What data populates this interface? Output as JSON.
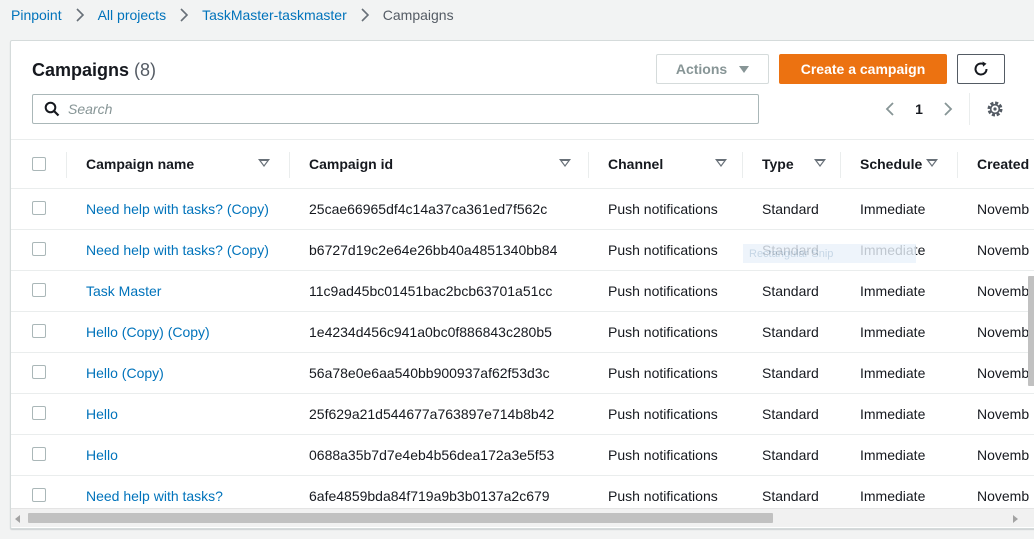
{
  "breadcrumb": [
    {
      "label": "Pinpoint",
      "link": true
    },
    {
      "label": "All projects",
      "link": true
    },
    {
      "label": "TaskMaster-taskmaster",
      "link": true
    },
    {
      "label": "Campaigns",
      "link": false
    }
  ],
  "panel": {
    "title": "Campaigns",
    "count": "(8)",
    "actions_label": "Actions",
    "create_label": "Create a campaign",
    "search_placeholder": "Search",
    "current_page": "1"
  },
  "columns": [
    {
      "label": "Campaign name"
    },
    {
      "label": "Campaign id"
    },
    {
      "label": "Channel"
    },
    {
      "label": "Type"
    },
    {
      "label": "Schedule"
    },
    {
      "label": "Created"
    }
  ],
  "rows": [
    {
      "name": "Need help with tasks? (Copy)",
      "id": "25cae66965df4c14a37ca361ed7f562c",
      "channel": "Push notifications",
      "type": "Standard",
      "schedule": "Immediate",
      "created": "Novemb"
    },
    {
      "name": "Need help with tasks? (Copy)",
      "id": "b6727d19c2e64e26bb40a4851340bb84",
      "channel": "Push notifications",
      "type": "Standard",
      "schedule": "Immediate",
      "created": "Novemb"
    },
    {
      "name": "Task Master",
      "id": "11c9ad45bc01451bac2bcb63701a51cc",
      "channel": "Push notifications",
      "type": "Standard",
      "schedule": "Immediate",
      "created": "Novemb"
    },
    {
      "name": "Hello (Copy) (Copy)",
      "id": "1e4234d456c941a0bc0f886843c280b5",
      "channel": "Push notifications",
      "type": "Standard",
      "schedule": "Immediate",
      "created": "Novemb"
    },
    {
      "name": "Hello (Copy)",
      "id": "56a78e0e6aa540bb900937af62f53d3c",
      "channel": "Push notifications",
      "type": "Standard",
      "schedule": "Immediate",
      "created": "Novemb"
    },
    {
      "name": "Hello",
      "id": "25f629a21d544677a763897e714b8b42",
      "channel": "Push notifications",
      "type": "Standard",
      "schedule": "Immediate",
      "created": "Novemb"
    },
    {
      "name": "Hello",
      "id": "0688a35b7d7e4eb4b56dea172a3e5f53",
      "channel": "Push notifications",
      "type": "Standard",
      "schedule": "Immediate",
      "created": "Novemb"
    },
    {
      "name": "Need help with tasks?",
      "id": "6afe4859bda84f719a9b3b0137a2c679",
      "channel": "Push notifications",
      "type": "Standard",
      "schedule": "Immediate",
      "created": "Novemb"
    }
  ],
  "overlay": {
    "text": "Rectangular Snip"
  },
  "colors": {
    "accent": "#ec7211",
    "link": "#0073bb",
    "text": "#16191f",
    "background": "#f2f3f3"
  }
}
